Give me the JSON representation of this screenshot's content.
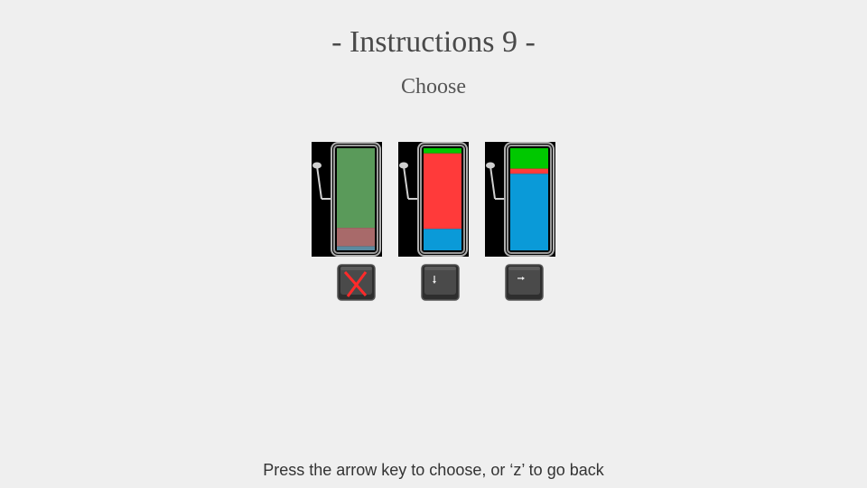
{
  "header": {
    "title": "- Instructions 9 -",
    "subtitle": "Choose"
  },
  "options": [
    {
      "state": "disabled",
      "key_icon": "crossed-out-key-icon",
      "bar_fractions": {
        "green": 0.78,
        "red": 0.18,
        "blue": 0.04
      }
    },
    {
      "state": "available",
      "key_icon": "down-arrow-key-icon",
      "bar_fractions": {
        "green": 0.05,
        "red": 0.74,
        "blue": 0.21
      }
    },
    {
      "state": "available",
      "key_icon": "right-arrow-key-icon",
      "bar_fractions": {
        "green": 0.2,
        "red": 0.05,
        "blue": 0.75
      }
    }
  ],
  "colors": {
    "background": "#efefef",
    "green": "#00c800",
    "red": "#ff3a3a",
    "blue": "#0a9ad8",
    "disabled_green": "#5a9a5a",
    "disabled_red": "#a86a6a",
    "disabled_blue": "#5a8aa0"
  },
  "footer": {
    "instruction": "Press the arrow key to choose, or ‘z’ to go back"
  }
}
